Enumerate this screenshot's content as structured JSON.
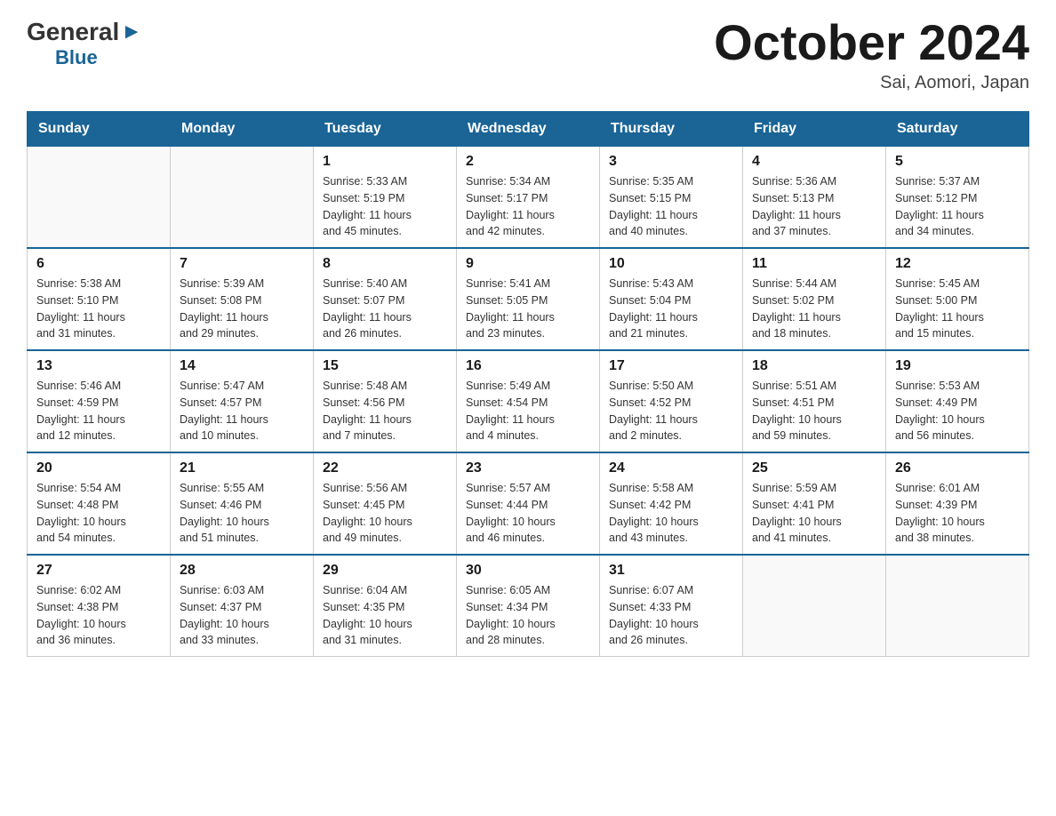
{
  "header": {
    "logo_general": "General",
    "logo_blue": "Blue",
    "month_title": "October 2024",
    "location": "Sai, Aomori, Japan"
  },
  "days_of_week": [
    "Sunday",
    "Monday",
    "Tuesday",
    "Wednesday",
    "Thursday",
    "Friday",
    "Saturday"
  ],
  "weeks": [
    [
      {
        "day": "",
        "info": ""
      },
      {
        "day": "",
        "info": ""
      },
      {
        "day": "1",
        "info": "Sunrise: 5:33 AM\nSunset: 5:19 PM\nDaylight: 11 hours\nand 45 minutes."
      },
      {
        "day": "2",
        "info": "Sunrise: 5:34 AM\nSunset: 5:17 PM\nDaylight: 11 hours\nand 42 minutes."
      },
      {
        "day": "3",
        "info": "Sunrise: 5:35 AM\nSunset: 5:15 PM\nDaylight: 11 hours\nand 40 minutes."
      },
      {
        "day": "4",
        "info": "Sunrise: 5:36 AM\nSunset: 5:13 PM\nDaylight: 11 hours\nand 37 minutes."
      },
      {
        "day": "5",
        "info": "Sunrise: 5:37 AM\nSunset: 5:12 PM\nDaylight: 11 hours\nand 34 minutes."
      }
    ],
    [
      {
        "day": "6",
        "info": "Sunrise: 5:38 AM\nSunset: 5:10 PM\nDaylight: 11 hours\nand 31 minutes."
      },
      {
        "day": "7",
        "info": "Sunrise: 5:39 AM\nSunset: 5:08 PM\nDaylight: 11 hours\nand 29 minutes."
      },
      {
        "day": "8",
        "info": "Sunrise: 5:40 AM\nSunset: 5:07 PM\nDaylight: 11 hours\nand 26 minutes."
      },
      {
        "day": "9",
        "info": "Sunrise: 5:41 AM\nSunset: 5:05 PM\nDaylight: 11 hours\nand 23 minutes."
      },
      {
        "day": "10",
        "info": "Sunrise: 5:43 AM\nSunset: 5:04 PM\nDaylight: 11 hours\nand 21 minutes."
      },
      {
        "day": "11",
        "info": "Sunrise: 5:44 AM\nSunset: 5:02 PM\nDaylight: 11 hours\nand 18 minutes."
      },
      {
        "day": "12",
        "info": "Sunrise: 5:45 AM\nSunset: 5:00 PM\nDaylight: 11 hours\nand 15 minutes."
      }
    ],
    [
      {
        "day": "13",
        "info": "Sunrise: 5:46 AM\nSunset: 4:59 PM\nDaylight: 11 hours\nand 12 minutes."
      },
      {
        "day": "14",
        "info": "Sunrise: 5:47 AM\nSunset: 4:57 PM\nDaylight: 11 hours\nand 10 minutes."
      },
      {
        "day": "15",
        "info": "Sunrise: 5:48 AM\nSunset: 4:56 PM\nDaylight: 11 hours\nand 7 minutes."
      },
      {
        "day": "16",
        "info": "Sunrise: 5:49 AM\nSunset: 4:54 PM\nDaylight: 11 hours\nand 4 minutes."
      },
      {
        "day": "17",
        "info": "Sunrise: 5:50 AM\nSunset: 4:52 PM\nDaylight: 11 hours\nand 2 minutes."
      },
      {
        "day": "18",
        "info": "Sunrise: 5:51 AM\nSunset: 4:51 PM\nDaylight: 10 hours\nand 59 minutes."
      },
      {
        "day": "19",
        "info": "Sunrise: 5:53 AM\nSunset: 4:49 PM\nDaylight: 10 hours\nand 56 minutes."
      }
    ],
    [
      {
        "day": "20",
        "info": "Sunrise: 5:54 AM\nSunset: 4:48 PM\nDaylight: 10 hours\nand 54 minutes."
      },
      {
        "day": "21",
        "info": "Sunrise: 5:55 AM\nSunset: 4:46 PM\nDaylight: 10 hours\nand 51 minutes."
      },
      {
        "day": "22",
        "info": "Sunrise: 5:56 AM\nSunset: 4:45 PM\nDaylight: 10 hours\nand 49 minutes."
      },
      {
        "day": "23",
        "info": "Sunrise: 5:57 AM\nSunset: 4:44 PM\nDaylight: 10 hours\nand 46 minutes."
      },
      {
        "day": "24",
        "info": "Sunrise: 5:58 AM\nSunset: 4:42 PM\nDaylight: 10 hours\nand 43 minutes."
      },
      {
        "day": "25",
        "info": "Sunrise: 5:59 AM\nSunset: 4:41 PM\nDaylight: 10 hours\nand 41 minutes."
      },
      {
        "day": "26",
        "info": "Sunrise: 6:01 AM\nSunset: 4:39 PM\nDaylight: 10 hours\nand 38 minutes."
      }
    ],
    [
      {
        "day": "27",
        "info": "Sunrise: 6:02 AM\nSunset: 4:38 PM\nDaylight: 10 hours\nand 36 minutes."
      },
      {
        "day": "28",
        "info": "Sunrise: 6:03 AM\nSunset: 4:37 PM\nDaylight: 10 hours\nand 33 minutes."
      },
      {
        "day": "29",
        "info": "Sunrise: 6:04 AM\nSunset: 4:35 PM\nDaylight: 10 hours\nand 31 minutes."
      },
      {
        "day": "30",
        "info": "Sunrise: 6:05 AM\nSunset: 4:34 PM\nDaylight: 10 hours\nand 28 minutes."
      },
      {
        "day": "31",
        "info": "Sunrise: 6:07 AM\nSunset: 4:33 PM\nDaylight: 10 hours\nand 26 minutes."
      },
      {
        "day": "",
        "info": ""
      },
      {
        "day": "",
        "info": ""
      }
    ]
  ]
}
